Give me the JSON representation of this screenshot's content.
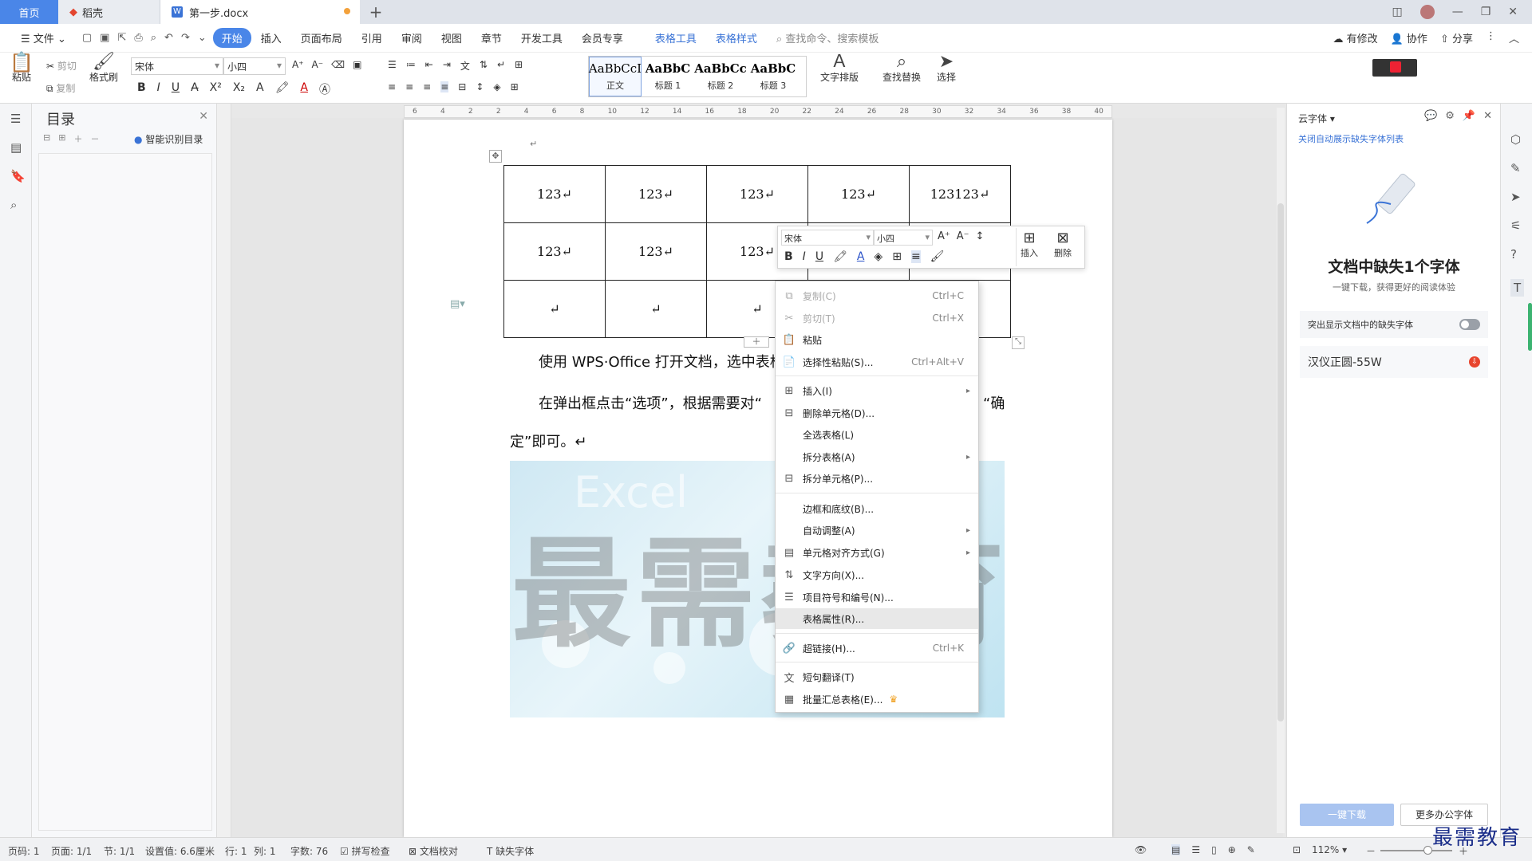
{
  "tabs": {
    "home": "首页",
    "dk": "稻壳",
    "doc": "第一步.docx",
    "plus": "+"
  },
  "window": {
    "min": "—",
    "restore": "❐",
    "close": "✕"
  },
  "menu": {
    "file": "文件",
    "items": [
      "开始",
      "插入",
      "页面布局",
      "引用",
      "审阅",
      "视图",
      "章节",
      "开发工具",
      "会员专享"
    ],
    "context_tabs": [
      "表格工具",
      "表格样式"
    ],
    "search": "查找命令、搜索模板",
    "right": [
      "有修改",
      "协作",
      "分享"
    ]
  },
  "ribbon": {
    "paste": "粘贴",
    "cut": "剪切",
    "copy": "复制",
    "format_painter": "格式刷",
    "font_name": "宋体",
    "font_size": "小四",
    "styles": [
      {
        "preview": "AaBbCcI",
        "label": "正文"
      },
      {
        "preview": "AaBbC",
        "label": "标题 1"
      },
      {
        "preview": "AaBbCc",
        "label": "标题 2"
      },
      {
        "preview": "AaBbC",
        "label": "标题 3"
      }
    ],
    "text_layout": "文字排版",
    "find_replace": "查找替换",
    "select": "选择"
  },
  "nav": {
    "title": "目录",
    "smart": "智能识别目录"
  },
  "ruler": {
    "h_ticks": [
      "6",
      "4",
      "2",
      "2",
      "4",
      "6",
      "8",
      "10",
      "12",
      "14",
      "16",
      "18",
      "20",
      "22",
      "24",
      "26",
      "28",
      "30",
      "32",
      "34",
      "36",
      "38",
      "40"
    ]
  },
  "document": {
    "table": [
      [
        "123↵",
        "123↵",
        "123↵",
        "123↵",
        "123123↵"
      ],
      [
        "123↵",
        "123↵",
        "123↵",
        "",
        ""
      ],
      [
        "↵",
        "↵",
        "↵",
        "",
        ""
      ]
    ],
    "para1": "使用 WPS·Office 打开文档，选中表格",
    "para2_left": "在弹出框点击“选项”，根据需要对“",
    "para2_right": "“确",
    "para3": "定”即可。↵",
    "image_watermark": "最需教育",
    "image_sub": "Excel"
  },
  "mini_toolbar": {
    "font": "宋体",
    "size": "小四",
    "insert": "插入",
    "delete": "删除"
  },
  "context_menu": [
    {
      "label": "复制(C)",
      "shortcut": "Ctrl+C",
      "icon": "copy-icon",
      "disabled": true
    },
    {
      "label": "剪切(T)",
      "shortcut": "Ctrl+X",
      "icon": "cut-icon",
      "disabled": true
    },
    {
      "label": "粘贴",
      "shortcut": "",
      "icon": "paste-icon"
    },
    {
      "label": "选择性粘贴(S)...",
      "shortcut": "Ctrl+Alt+V",
      "icon": "paste-special-icon"
    },
    {
      "label": "插入(I)",
      "shortcut": "",
      "icon": "table-insert-icon",
      "submenu": true
    },
    {
      "label": "删除单元格(D)...",
      "shortcut": "",
      "icon": "delete-cell-icon"
    },
    {
      "label": "全选表格(L)",
      "shortcut": "",
      "icon": ""
    },
    {
      "label": "拆分表格(A)",
      "shortcut": "",
      "icon": "",
      "submenu": true
    },
    {
      "label": "拆分单元格(P)...",
      "shortcut": "",
      "icon": "split-cell-icon"
    },
    {
      "label": "边框和底纹(B)...",
      "shortcut": "",
      "icon": ""
    },
    {
      "label": "自动调整(A)",
      "shortcut": "",
      "icon": "",
      "submenu": true
    },
    {
      "label": "单元格对齐方式(G)",
      "shortcut": "",
      "icon": "align-icon",
      "submenu": true
    },
    {
      "label": "文字方向(X)...",
      "shortcut": "",
      "icon": "text-direction-icon"
    },
    {
      "label": "项目符号和编号(N)...",
      "shortcut": "",
      "icon": "list-icon"
    },
    {
      "label": "表格属性(R)...",
      "shortcut": "",
      "icon": "",
      "highlighted": true
    },
    {
      "label": "超链接(H)...",
      "shortcut": "Ctrl+K",
      "icon": "link-icon"
    },
    {
      "label": "短句翻译(T)",
      "shortcut": "",
      "icon": "translate-icon"
    },
    {
      "label": "批量汇总表格(E)...",
      "shortcut": "",
      "icon": "batch-icon"
    }
  ],
  "right_pane": {
    "title": "云字体",
    "link": "关闭自动展示缺失字体列表",
    "headline": "文档中缺失1个字体",
    "sub": "一键下载，获得更好的阅读体验",
    "toggle_label": "突出显示文档中的缺失字体",
    "font_item": "汉仪正圆-55W",
    "download": "一键下载",
    "more": "更多办公字体"
  },
  "status": {
    "page": "页码: 1",
    "pages": "页面: 1/1",
    "section": "节: 1/1",
    "setting": "设置值: 6.6厘米",
    "row": "行: 1",
    "col": "列: 1",
    "words": "字数: 76",
    "spell": "拼写检查",
    "proof": "文档校对",
    "missing_font": "缺失字体",
    "zoom": "112%"
  },
  "brand": "最需教育",
  "colors": {
    "accent": "#4a86e8",
    "tab_home_bg": "#4a86e8",
    "modified_dot": "#f3a13b",
    "brand": "#1b2e8a"
  }
}
